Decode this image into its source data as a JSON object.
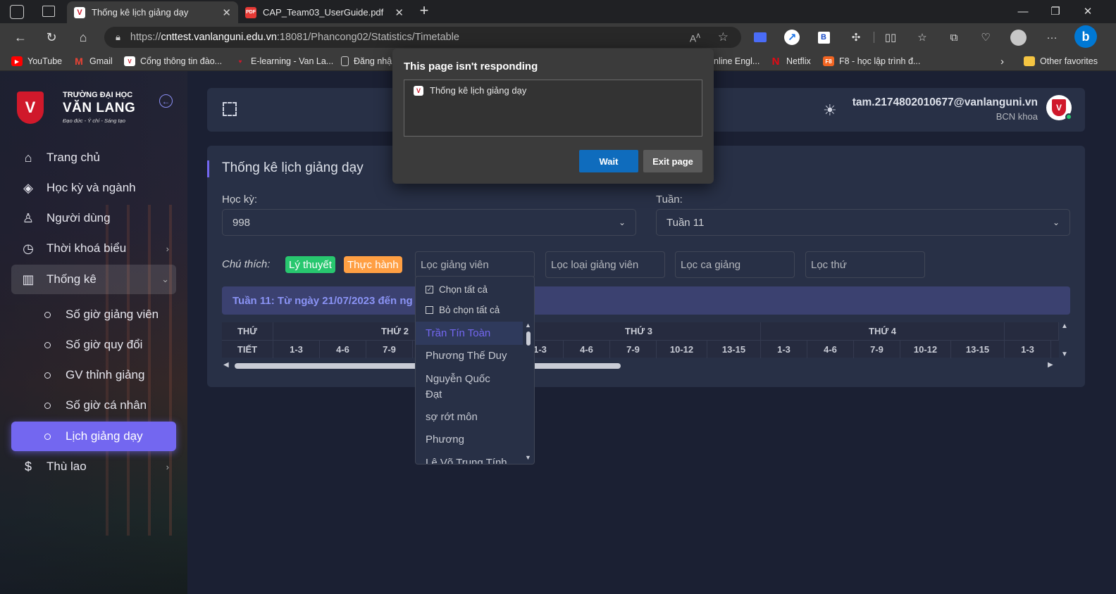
{
  "browser": {
    "tabs": [
      {
        "title": "Thống kê lịch giảng dạy",
        "active": true,
        "icon": "vlu-favicon"
      },
      {
        "title": "CAP_Team03_UserGuide.pdf",
        "active": false,
        "icon": "pdf-icon"
      }
    ],
    "address": {
      "scheme": "https://",
      "host": "cnttest.vanlanguni.edu.vn",
      "path": ":18081/Phancong02/Statistics/Timetable"
    },
    "bookmarks": [
      {
        "label": "YouTube",
        "icon": "youtube-icon",
        "color": "#ff0000"
      },
      {
        "label": "Gmail",
        "icon": "gmail-icon",
        "color": "#ea4335"
      },
      {
        "label": "Cổng thông tin đào...",
        "icon": "vlu-icon",
        "color": "#d0192b"
      },
      {
        "label": "E-learning - Van La...",
        "icon": "vlu-icon",
        "color": "#d0192b"
      },
      {
        "label": "Đăng nhậ",
        "icon": "page-icon",
        "color": "#cccccc"
      },
      {
        "label": "nline Engl...",
        "icon": "",
        "color": ""
      },
      {
        "label": "Netflix",
        "icon": "netflix-icon",
        "color": "#e50914"
      },
      {
        "label": "F8 - học lập trình đ...",
        "icon": "f8-icon",
        "color": "#f26522"
      }
    ],
    "other_favorites": "Other favorites"
  },
  "sidebar": {
    "logo": {
      "line1": "TRƯỜNG ĐẠI HỌC",
      "line2": "VĂN LANG",
      "slogan": "Đạo đức - Ý chí - Sáng tạo"
    },
    "items": [
      {
        "label": "Trang chủ",
        "icon": "home-icon"
      },
      {
        "label": "Học kỳ và ngành",
        "icon": "layers-icon"
      },
      {
        "label": "Người dùng",
        "icon": "user-icon"
      },
      {
        "label": "Thời khoá biểu",
        "icon": "clock-icon"
      },
      {
        "label": "Thống kê",
        "icon": "bar-chart-icon"
      }
    ],
    "subitems": [
      {
        "label": "Số giờ giảng viên"
      },
      {
        "label": "Số giờ quy đổi"
      },
      {
        "label": "GV thỉnh giảng"
      },
      {
        "label": "Số giờ cá nhân"
      },
      {
        "label": "Lịch giảng dạy",
        "active": true
      }
    ],
    "last_item": {
      "label": "Thù lao",
      "icon": "dollar-icon"
    }
  },
  "header": {
    "email": "tam.2174802010677@vanlanguni.vn",
    "role": "BCN khoa"
  },
  "main": {
    "title": "Thống kê lịch giảng dạy",
    "semester_label": "Học kỳ:",
    "semester_value": "998",
    "week_label": "Tuần:",
    "week_value": "Tuần 11",
    "legend_label": "Chú thích:",
    "legend": [
      {
        "label": "Lý thuyết",
        "color": "#28c76f"
      },
      {
        "label": "Thực hành",
        "color": "#ff9f43"
      }
    ],
    "filters": [
      "Lọc giảng viên",
      "Lọc loại giảng viên",
      "Lọc ca giảng",
      "Lọc thứ"
    ],
    "week_banner": "Tuần 11: Từ ngày 21/07/2023 đến ng",
    "table": {
      "corner_top": "THỨ",
      "corner_bottom": "TIẾT",
      "days": [
        "THỨ 2",
        "THỨ 3",
        "THỨ 4"
      ],
      "periods": [
        "1-3",
        "4-6",
        "7-9",
        "10-12",
        "13-15"
      ]
    }
  },
  "lecturer_dropdown": {
    "select_all": "Chọn tất cả",
    "deselect_all": "Bỏ chọn tất cả",
    "options": [
      "Trần Tín Toàn",
      "Phương Thế Duy",
      "Nguyễn Quốc Đạt",
      "sợ rớt môn",
      "Phương",
      "Lê Võ Trung Tính"
    ],
    "selected_index": 0
  },
  "dialog": {
    "title": "This page isn't responding",
    "item": "Thống kê lịch giảng dạy",
    "wait": "Wait",
    "exit": "Exit page"
  }
}
